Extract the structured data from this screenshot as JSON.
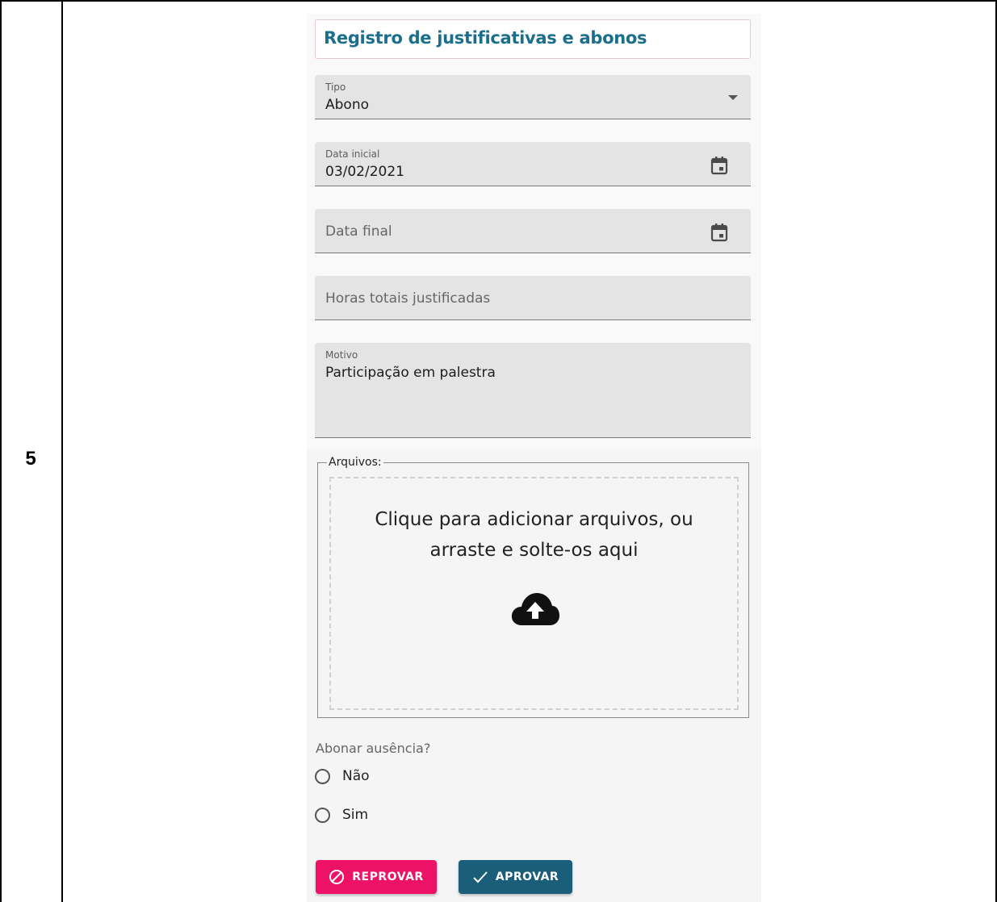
{
  "document": {
    "step_number": "5"
  },
  "form": {
    "title": "Registro de justificativas e abonos",
    "tipo": {
      "label": "Tipo",
      "value": "Abono",
      "icon": "dropdown-arrow-icon"
    },
    "data_inicial": {
      "label": "Data inicial",
      "value": "03/02/2021",
      "icon": "calendar-icon"
    },
    "data_final": {
      "placeholder": "Data final",
      "icon": "calendar-icon"
    },
    "horas": {
      "placeholder": "Horas totais justificadas"
    },
    "motivo": {
      "label": "Motivo",
      "value": "Participação em palestra"
    },
    "arquivos": {
      "legend": "Arquivos:",
      "drop_line1": "Clique para adicionar arquivos, ou",
      "drop_line2": "arraste e solte-os aqui",
      "icon": "cloud-upload-icon"
    },
    "abonar": {
      "question": "Abonar ausência?",
      "options": [
        "Não",
        "Sim"
      ],
      "selected": null
    },
    "actions": {
      "reject_label": "REPROVAR",
      "reject_icon": "block-icon",
      "approve_label": "APROVAR",
      "approve_icon": "check-icon"
    }
  },
  "colors": {
    "title": "#1b6e8c",
    "reject": "#ee1266",
    "approve": "#1a5e7a",
    "field_bg": "#e4e4e4"
  }
}
